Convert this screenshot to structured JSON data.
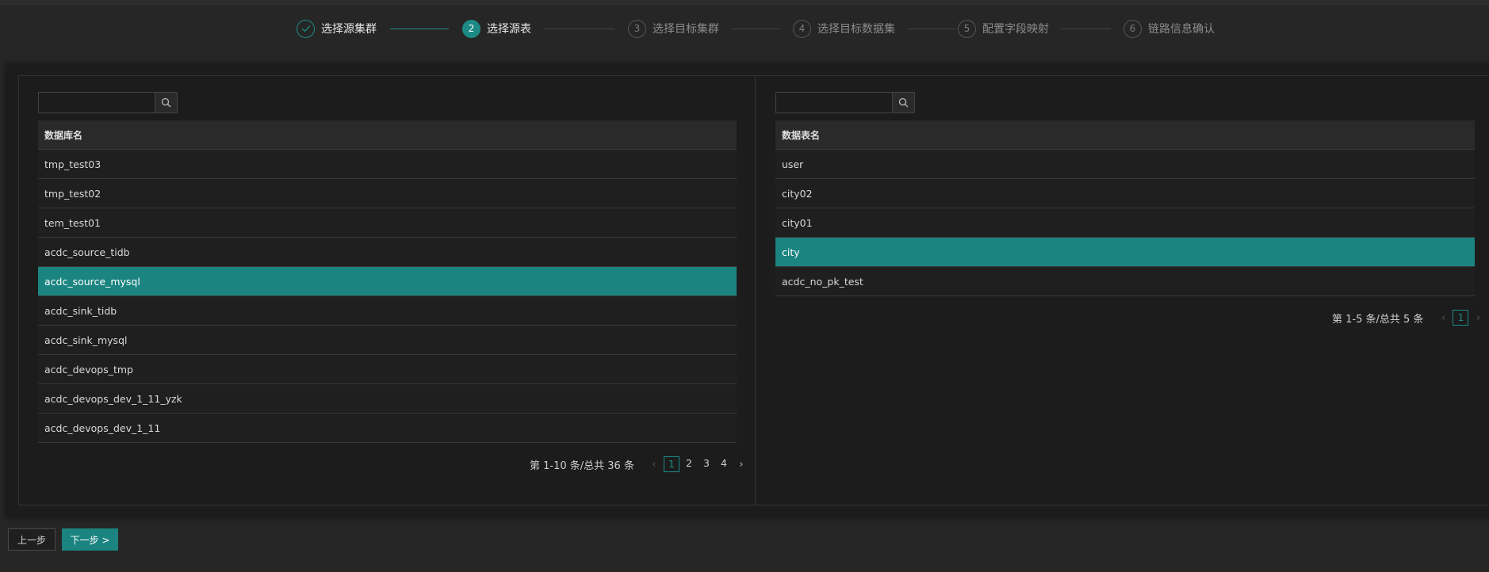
{
  "steps": [
    {
      "number": "1",
      "label": "选择源集群",
      "state": "done"
    },
    {
      "number": "2",
      "label": "选择源表",
      "state": "active"
    },
    {
      "number": "3",
      "label": "选择目标集群",
      "state": "pending"
    },
    {
      "number": "4",
      "label": "选择目标数据集",
      "state": "pending"
    },
    {
      "number": "5",
      "label": "配置字段映射",
      "state": "pending"
    },
    {
      "number": "6",
      "label": "链路信息确认",
      "state": "pending"
    }
  ],
  "left_panel": {
    "search": {
      "value": "",
      "placeholder": ""
    },
    "column_header": "数据库名",
    "rows": [
      "tmp_test03",
      "tmp_test02",
      "tem_test01",
      "acdc_source_tidb",
      "acdc_source_mysql",
      "acdc_sink_tidb",
      "acdc_sink_mysql",
      "acdc_devops_tmp",
      "acdc_devops_dev_1_11_yzk",
      "acdc_devops_dev_1_11"
    ],
    "selected_index": 4,
    "pagination": {
      "total_text": "第 1-10 条/总共 36 条",
      "pages": [
        "1",
        "2",
        "3",
        "4"
      ],
      "current": "1"
    }
  },
  "right_panel": {
    "search": {
      "value": "",
      "placeholder": ""
    },
    "column_header": "数据表名",
    "rows": [
      "user",
      "city02",
      "city01",
      "city",
      "acdc_no_pk_test"
    ],
    "selected_index": 3,
    "pagination": {
      "total_text": "第 1-5 条/总共 5 条",
      "pages": [
        "1"
      ],
      "current": "1"
    }
  },
  "footer": {
    "prev_label": "上一步",
    "next_label": "下一步 >"
  },
  "colors": {
    "accent": "#1b8480",
    "background": "#262626",
    "panel": "#1c1c1c"
  },
  "icons": {
    "search": "search-icon",
    "step_done": "check-icon",
    "pager_prev": "chevron-left-icon",
    "pager_next": "chevron-right-icon"
  }
}
